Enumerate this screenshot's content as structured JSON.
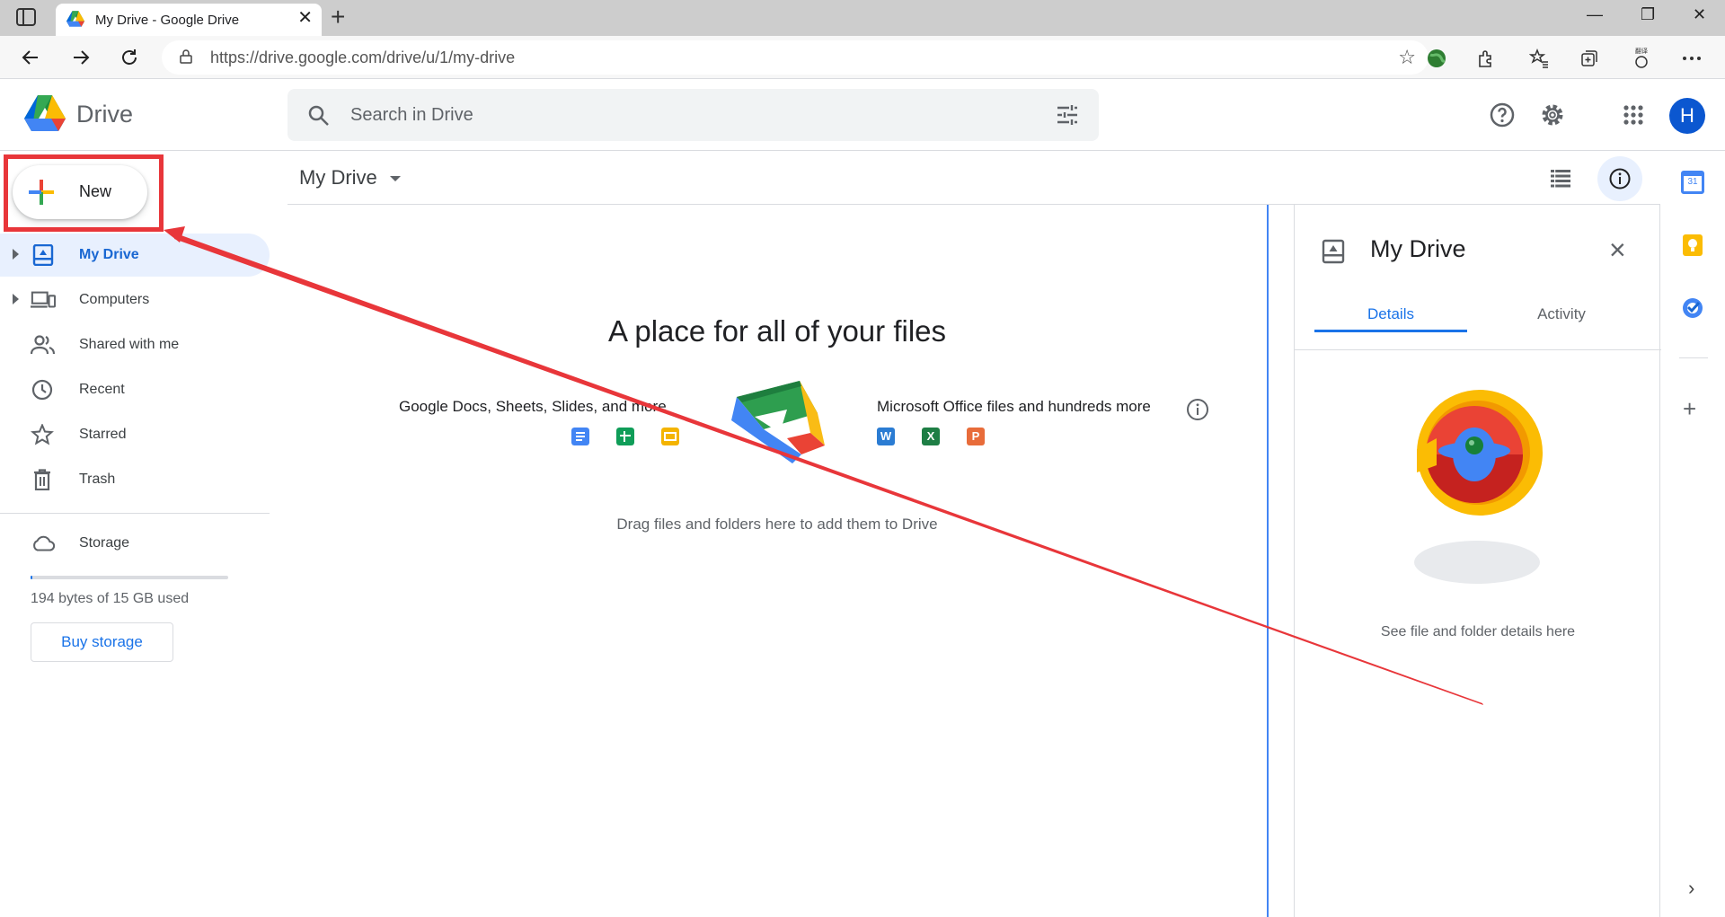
{
  "browser": {
    "tab_title": "My Drive - Google Drive",
    "tab_close": "✕",
    "new_tab": "+",
    "url": "https://drive.google.com/drive/u/1/my-drive",
    "window_controls": {
      "minimize": "—",
      "restore": "❐",
      "close": "✕"
    },
    "extension_label": "翻译"
  },
  "drive": {
    "app_name": "Drive",
    "search_placeholder": "Search in Drive",
    "avatar_letter": "H"
  },
  "sidebar": {
    "new_label": "New",
    "items": [
      {
        "label": "My Drive",
        "icon": "my-drive-icon",
        "active": true,
        "expandable": true
      },
      {
        "label": "Computers",
        "icon": "computers-icon",
        "active": false,
        "expandable": true
      },
      {
        "label": "Shared with me",
        "icon": "shared-icon",
        "active": false,
        "expandable": false
      },
      {
        "label": "Recent",
        "icon": "clock-icon",
        "active": false,
        "expandable": false
      },
      {
        "label": "Starred",
        "icon": "star-icon",
        "active": false,
        "expandable": false
      },
      {
        "label": "Trash",
        "icon": "trash-icon",
        "active": false,
        "expandable": false
      }
    ],
    "storage_label": "Storage",
    "storage_used": "194 bytes of 15 GB used",
    "storage_fraction": 0.01,
    "buy_storage": "Buy storage"
  },
  "main": {
    "title": "My Drive",
    "empty_title": "A place for all of your files",
    "google_caption": "Google Docs, Sheets, Slides, and more",
    "ms_caption": "Microsoft Office files and hundreds more",
    "ms_icons": {
      "word": "W",
      "excel": "X",
      "powerpoint": "P"
    },
    "drag_caption": "Drag files and folders here to add them to Drive"
  },
  "details_panel": {
    "title": "My Drive",
    "tabs": [
      "Details",
      "Activity"
    ],
    "active_tab": "Details",
    "caption": "See file and folder details here"
  },
  "side_panel": {
    "calendar_day": "31",
    "add": "+",
    "expand": "›"
  },
  "colors": {
    "accent": "#1a73e8",
    "annotation": "#e8363a",
    "active_nav_bg": "#e8f0fe"
  }
}
